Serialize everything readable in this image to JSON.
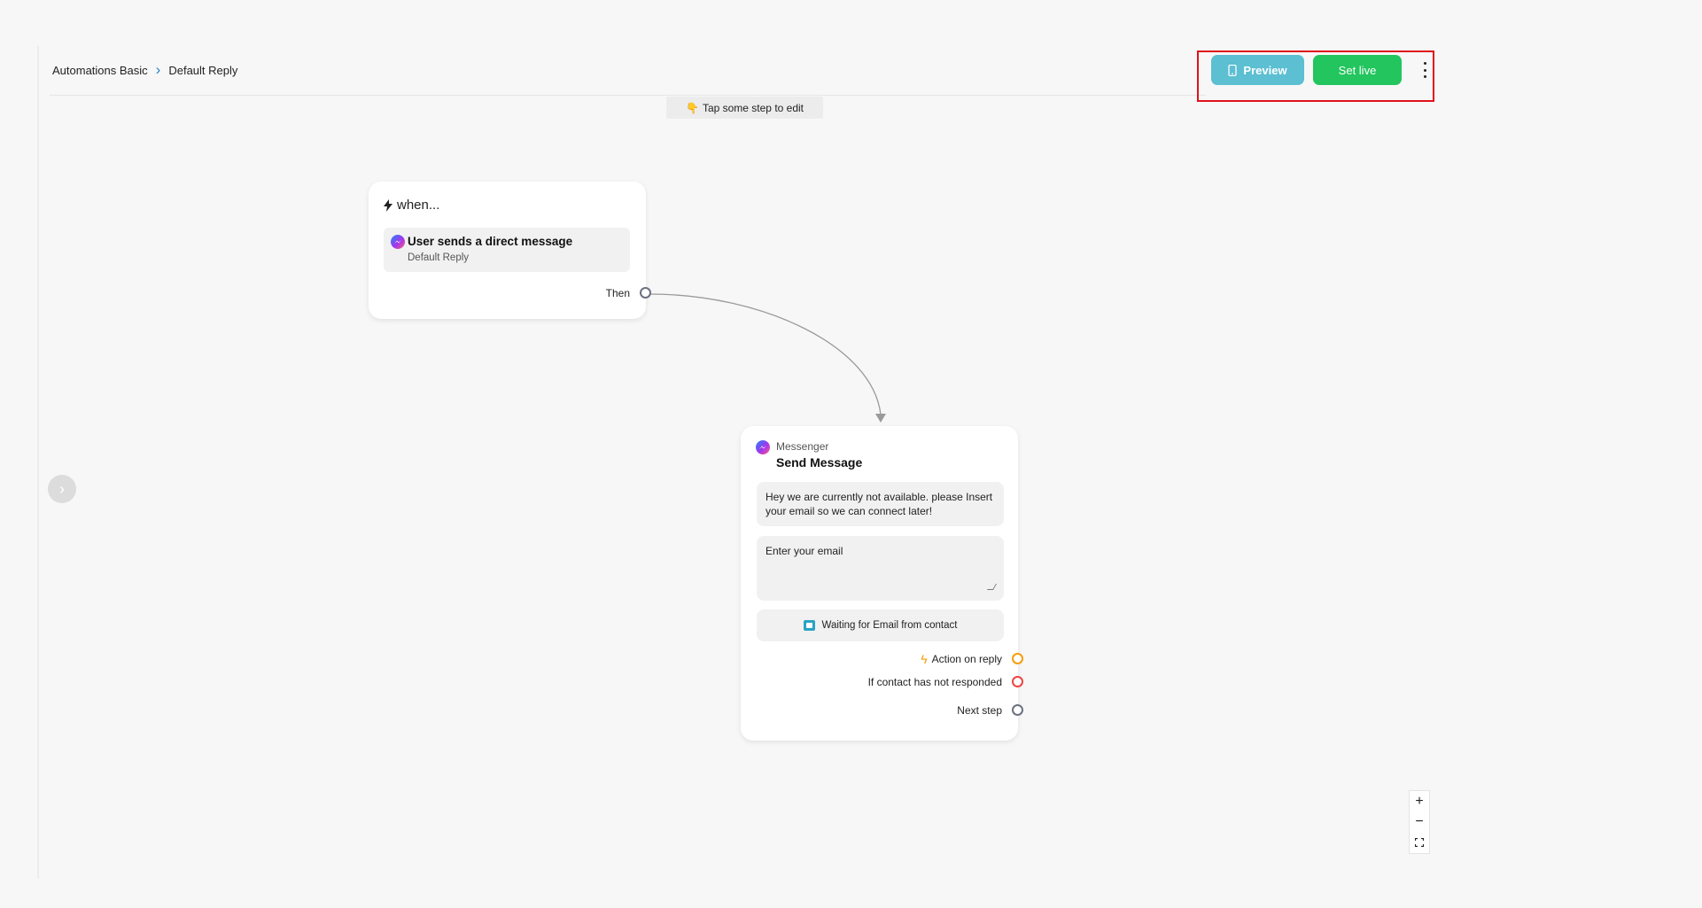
{
  "breadcrumb": {
    "parent": "Automations Basic",
    "current": "Default Reply"
  },
  "header": {
    "preview_label": "Preview",
    "set_live_label": "Set live"
  },
  "hint": {
    "emoji": "👇",
    "text": "Tap some step to edit"
  },
  "trigger": {
    "heading": "when...",
    "title": "User sends a direct message",
    "subtitle": "Default Reply",
    "output_label": "Then"
  },
  "message_step": {
    "channel": "Messenger",
    "title": "Send Message",
    "text": "Hey we are currently not available. please Insert your email so we can connect later!",
    "input_prompt": "Enter your email",
    "waiting_text": "Waiting for Email from contact",
    "outputs": {
      "action_on_reply": "Action on reply",
      "not_responded": "If contact has not responded",
      "next_step": "Next step"
    }
  },
  "colors": {
    "preview": "#5cbfd2",
    "set_live": "#22c55e",
    "highlight": "#e0121b",
    "action_port": "#f59e0b",
    "no_reply_port": "#ef4444",
    "next_port": "#6b7280"
  },
  "icons": {
    "preview": "phone-icon",
    "menu": "kebab-icon",
    "trigger": "bolt-icon",
    "channel": "messenger-icon",
    "waiting": "image-icon",
    "sidebar": "chevron-right-icon",
    "zoom_in": "plus-icon",
    "zoom_out": "minus-icon",
    "fit": "fit-view-icon"
  }
}
